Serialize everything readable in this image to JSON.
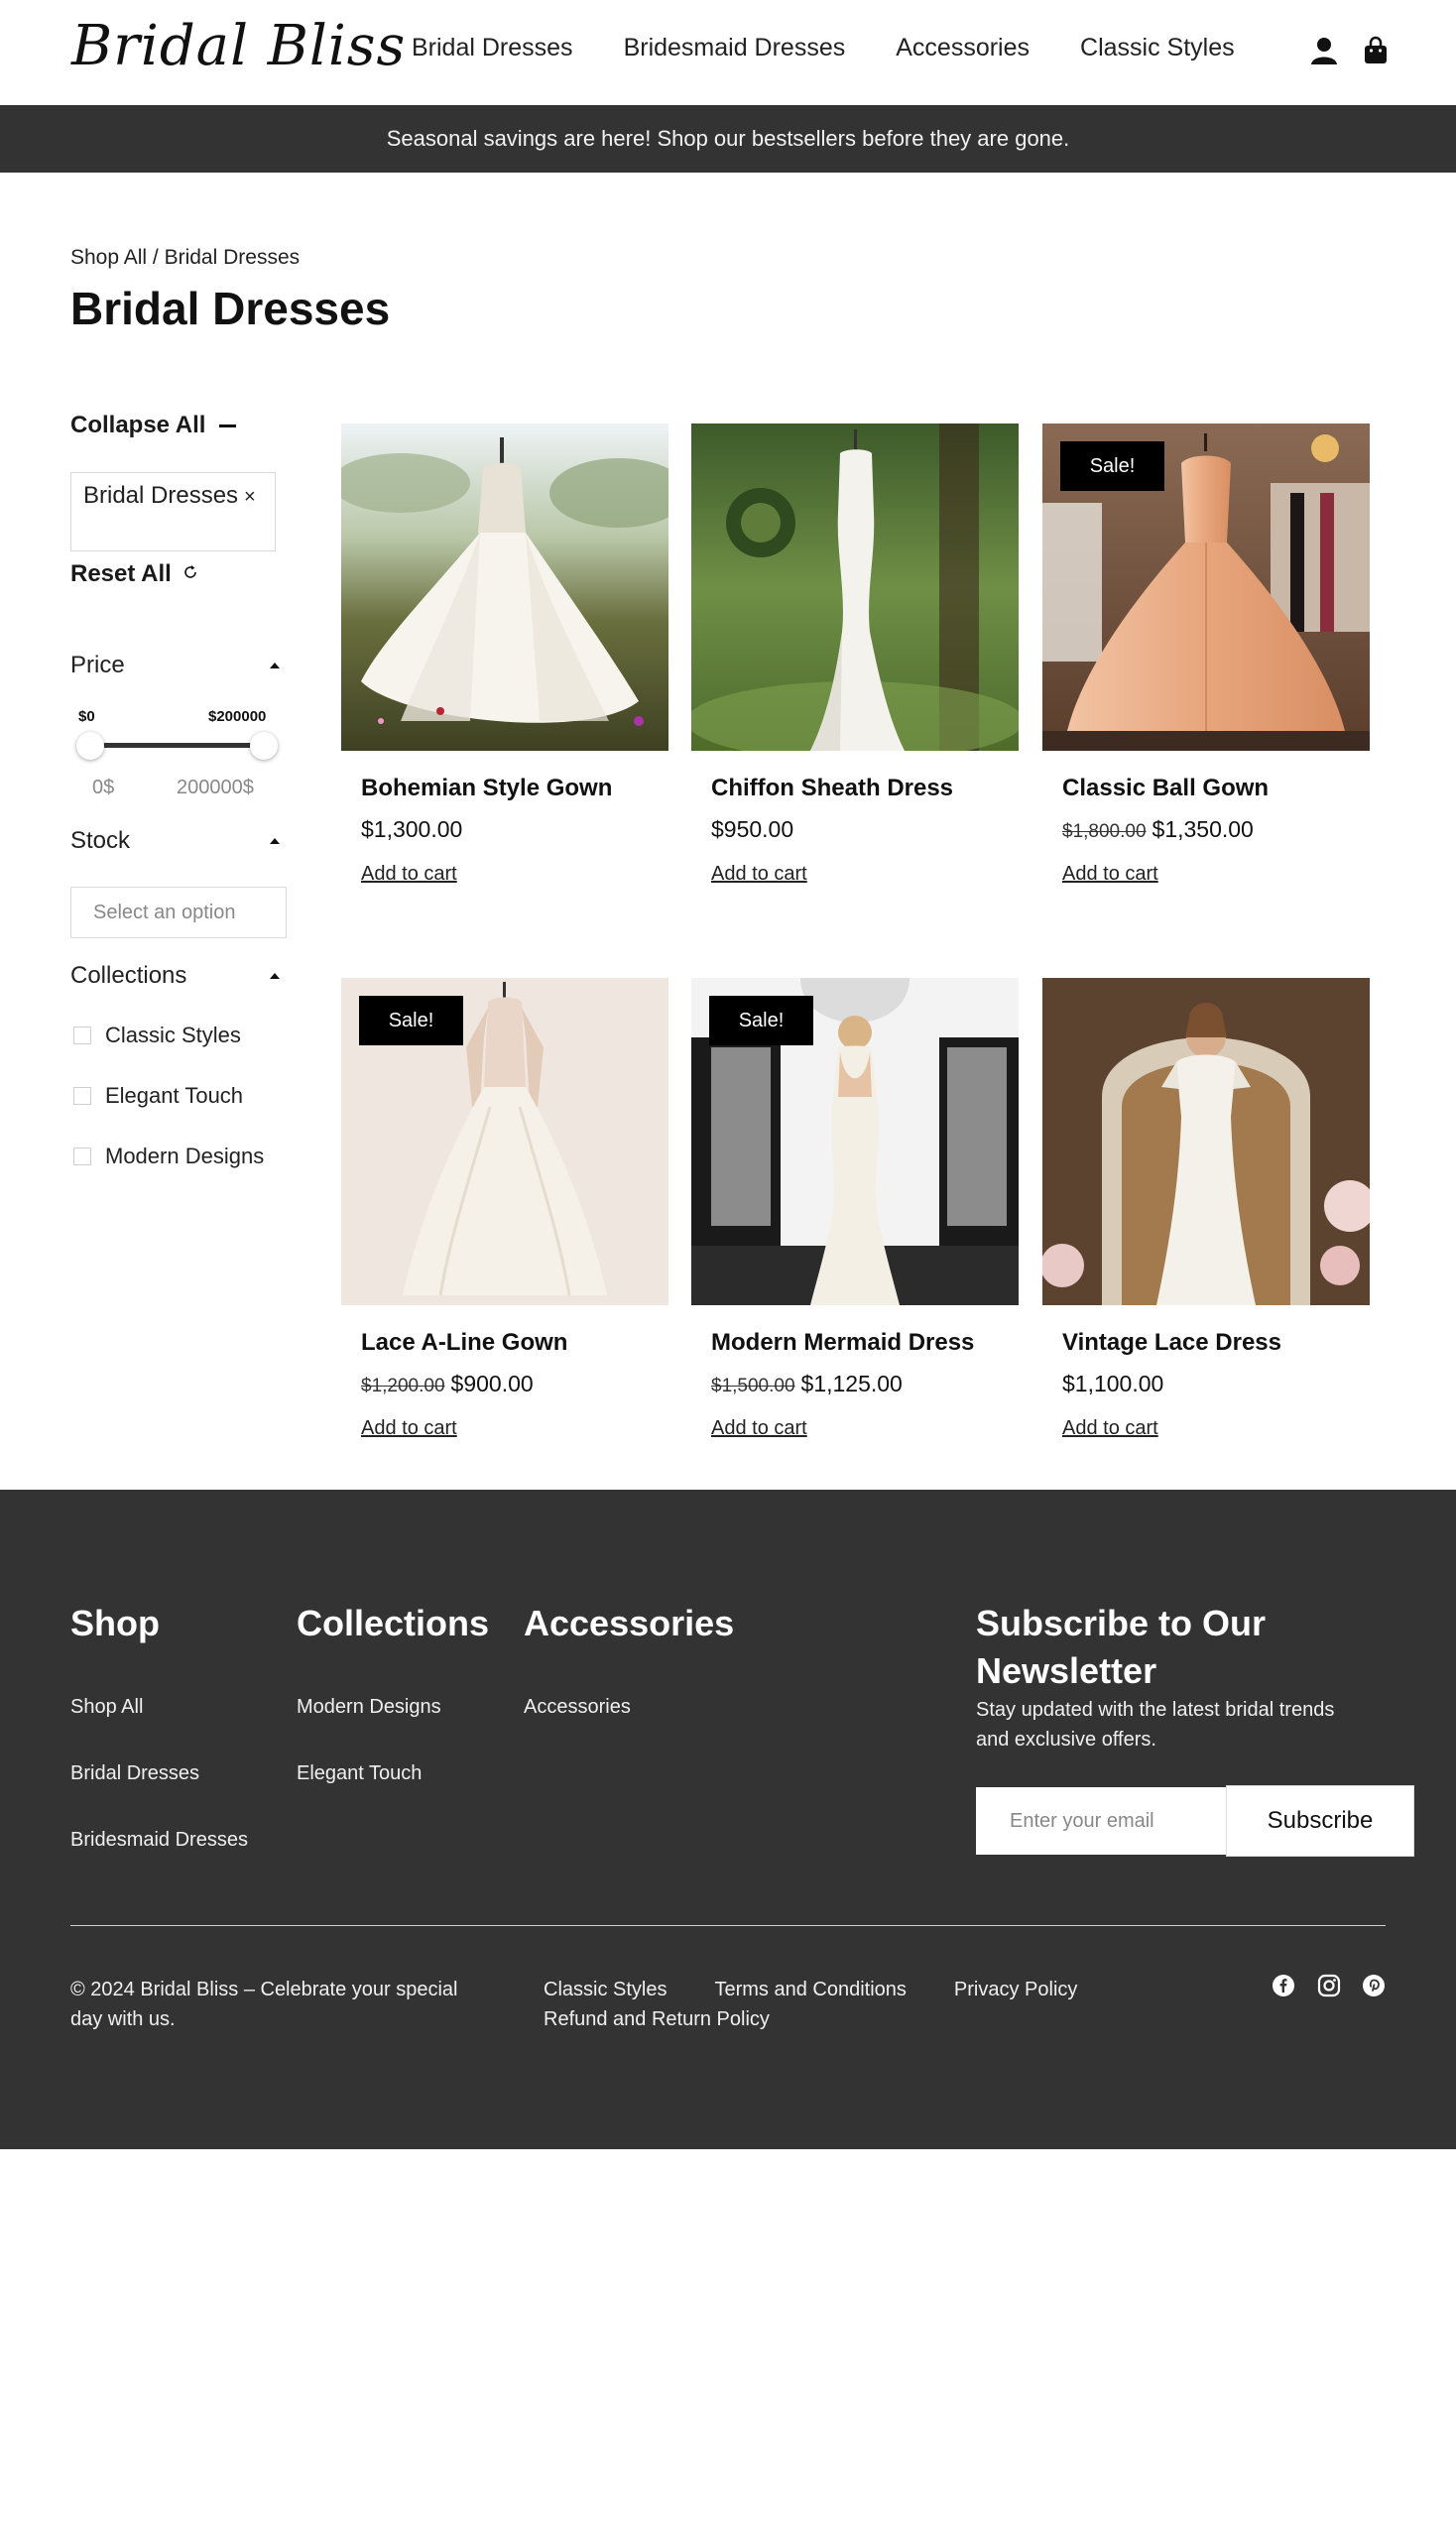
{
  "header": {
    "logo": "Bridal Bliss",
    "nav": [
      "Bridal Dresses",
      "Bridesmaid Dresses",
      "Accessories",
      "Classic Styles"
    ],
    "icons": [
      "user-icon",
      "shopping-bag-icon"
    ]
  },
  "promo": {
    "text": "Seasonal savings are here! Shop our bestsellers before they are gone."
  },
  "breadcrumb": {
    "root": "Shop All",
    "separator": " / ",
    "current": "Bridal Dresses"
  },
  "page_title": "Bridal Dresses",
  "sidebar": {
    "collapse_all": "Collapse All",
    "active_filter": "Bridal Dresses",
    "active_filter_remove": "×",
    "reset_all": "Reset All",
    "price": {
      "label": "Price",
      "min_label": "$0",
      "max_label": "$200000",
      "min_value": "0$",
      "max_value": "200000$"
    },
    "stock": {
      "label": "Stock",
      "placeholder": "Select an option"
    },
    "collections": {
      "label": "Collections",
      "items": [
        "Classic Styles",
        "Elegant Touch",
        "Modern Designs"
      ]
    }
  },
  "products": [
    {
      "name": "Bohemian Style Gown",
      "price": "$1,300.00",
      "old_price": "",
      "sale": false,
      "cta": "Add to cart"
    },
    {
      "name": "Chiffon Sheath Dress",
      "price": "$950.00",
      "old_price": "",
      "sale": false,
      "cta": "Add to cart"
    },
    {
      "name": "Classic Ball Gown",
      "price": "$1,350.00",
      "old_price": "$1,800.00",
      "sale": true,
      "sale_label": "Sale!",
      "cta": "Add to cart"
    },
    {
      "name": "Lace A-Line Gown",
      "price": "$900.00",
      "old_price": "$1,200.00",
      "sale": true,
      "sale_label": "Sale!",
      "cta": "Add to cart"
    },
    {
      "name": "Modern Mermaid Dress",
      "price": "$1,125.00",
      "old_price": "$1,500.00",
      "sale": true,
      "sale_label": "Sale!",
      "cta": "Add to cart"
    },
    {
      "name": "Vintage Lace Dress",
      "price": "$1,100.00",
      "old_price": "",
      "sale": false,
      "cta": "Add to cart"
    }
  ],
  "footer": {
    "shop": {
      "title": "Shop",
      "links": [
        "Shop All",
        "Bridal Dresses",
        "Bridesmaid Dresses"
      ]
    },
    "collections": {
      "title": "Collections",
      "links": [
        "Modern Designs",
        "Elegant Touch"
      ]
    },
    "accessories": {
      "title": "Accessories",
      "links": [
        "Accessories"
      ]
    },
    "newsletter": {
      "title": "Subscribe to Our Newsletter",
      "text": "Stay updated with the latest bridal trends and exclusive offers.",
      "placeholder": "Enter your email",
      "button": "Subscribe"
    },
    "copyright": "© 2024 Bridal Bliss – Celebrate your special day with us.",
    "legal": [
      "Classic Styles",
      "Terms and Conditions",
      "Privacy Policy",
      "Refund and Return Policy"
    ],
    "social": [
      "facebook-icon",
      "instagram-icon",
      "pinterest-icon"
    ]
  },
  "colors": {
    "dark_band": "#333333",
    "sale_badge": "#000000",
    "text": "#111111"
  }
}
